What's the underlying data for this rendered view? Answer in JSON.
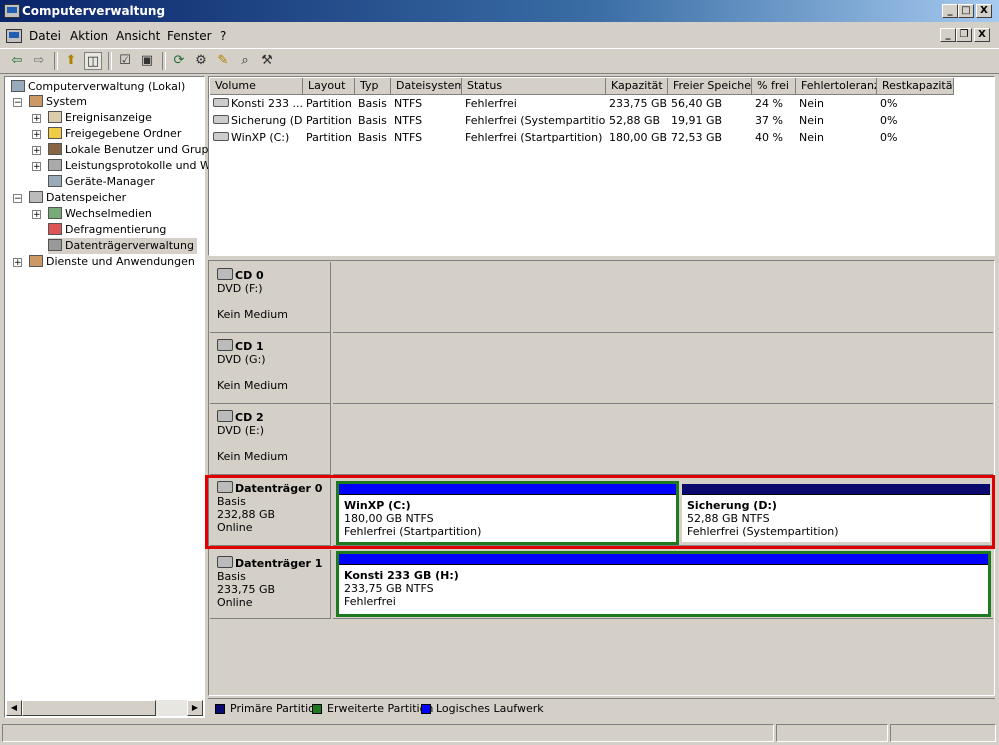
{
  "window": {
    "title": "Computerverwaltung",
    "min": "_",
    "max": "□",
    "close": "X",
    "child_min": "_",
    "child_restore": "❐",
    "child_close": "X"
  },
  "menu": [
    {
      "label": "Datei"
    },
    {
      "label": "Aktion"
    },
    {
      "label": "Ansicht"
    },
    {
      "label": "Fenster"
    },
    {
      "label": "?"
    }
  ],
  "toolbar": {
    "icons": [
      "back-icon",
      "forward-icon",
      "up-folder-icon",
      "show-hide-tree-icon",
      "properties-icon",
      "help-icon",
      "refresh-icon",
      "export-list-icon",
      "open-icon",
      "search-icon",
      "settings-icon"
    ]
  },
  "tree": {
    "root": "Computerverwaltung (Lokal)",
    "system": "System",
    "ereignis": "Ereignisanzeige",
    "ordner": "Freigegebene Ordner",
    "benutzer": "Lokale Benutzer und Gruppe",
    "leistung": "Leistungsprotokolle und War",
    "geraete": "Geräte-Manager",
    "datenspeicher": "Datenspeicher",
    "wechsel": "Wechselmedien",
    "defrag": "Defragmentierung",
    "dtv": "Datenträgerverwaltung",
    "dienste": "Dienste und Anwendungen"
  },
  "volumes": {
    "columns": [
      "Volume",
      "Layout",
      "Typ",
      "Dateisystem",
      "Status",
      "Kapazität",
      "Freier Speicher",
      "% frei",
      "Fehlertoleranz",
      "Restkapazität"
    ],
    "rows": [
      [
        "Konsti 233 ...",
        "Partition",
        "Basis",
        "NTFS",
        "Fehlerfrei",
        "233,75 GB",
        "56,40 GB",
        "24 %",
        "Nein",
        "0%"
      ],
      [
        "Sicherung (D:)",
        "Partition",
        "Basis",
        "NTFS",
        "Fehlerfrei (Systempartition)",
        "52,88 GB",
        "19,91 GB",
        "37 %",
        "Nein",
        "0%"
      ],
      [
        "WinXP (C:)",
        "Partition",
        "Basis",
        "NTFS",
        "Fehlerfrei (Startpartition)",
        "180,00 GB",
        "72,53 GB",
        "40 %",
        "Nein",
        "0%"
      ]
    ]
  },
  "disks": {
    "cd0": {
      "name": "CD 0",
      "type": "DVD (F:)",
      "status": "Kein Medium"
    },
    "cd1": {
      "name": "CD 1",
      "type": "DVD (G:)",
      "status": "Kein Medium"
    },
    "cd2": {
      "name": "CD 2",
      "type": "DVD (E:)",
      "status": "Kein Medium"
    },
    "d0": {
      "name": "Datenträger 0",
      "type": "Basis",
      "size": "232,88 GB",
      "status": "Online",
      "p1": {
        "title": "WinXP  (C:)",
        "size": "180,00 GB NTFS",
        "status": "Fehlerfrei (Startpartition)"
      },
      "p2": {
        "title": "Sicherung  (D:)",
        "size": "52,88 GB NTFS",
        "status": "Fehlerfrei (Systempartition)"
      }
    },
    "d1": {
      "name": "Datenträger 1",
      "type": "Basis",
      "size": "233,75 GB",
      "status": "Online",
      "p1": {
        "title": "Konsti 233 GB  (H:)",
        "size": "233,75 GB NTFS",
        "status": "Fehlerfrei"
      }
    }
  },
  "legend": {
    "primary": "Primäre Partition",
    "extended": "Erweiterte Partition",
    "logical": "Logisches Laufwerk"
  },
  "colors": {
    "primary": "#0a0a6e",
    "extended": "#1e7a1e",
    "logical": "#0000ff",
    "highlight": "#e00000"
  }
}
